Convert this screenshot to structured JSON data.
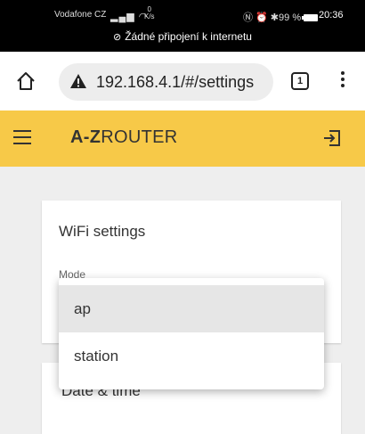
{
  "status_bar": {
    "carrier": "Vodafone CZ",
    "signal": "▂▄▆",
    "speed_value": "0",
    "speed_unit": "K/s",
    "icons": "Ⓝ ⏰ ✱",
    "battery_percent": "99 %",
    "time": "20:36",
    "no_internet": "Žádné připojení k internetu"
  },
  "browser": {
    "url": "192.168.4.1/#/settings",
    "tab_count": "1"
  },
  "app_bar": {
    "title_bold": "A-Z",
    "title_rest": "ROUTER"
  },
  "wifi_card": {
    "title": "WiFi settings",
    "mode_label": "Mode"
  },
  "datetime_card": {
    "title": "Date & time"
  },
  "mode_dropdown": {
    "options": [
      {
        "label": "ap",
        "selected": true
      },
      {
        "label": "station",
        "selected": false
      }
    ]
  },
  "colors": {
    "accent": "#f7c948",
    "background": "#eeeeee"
  }
}
